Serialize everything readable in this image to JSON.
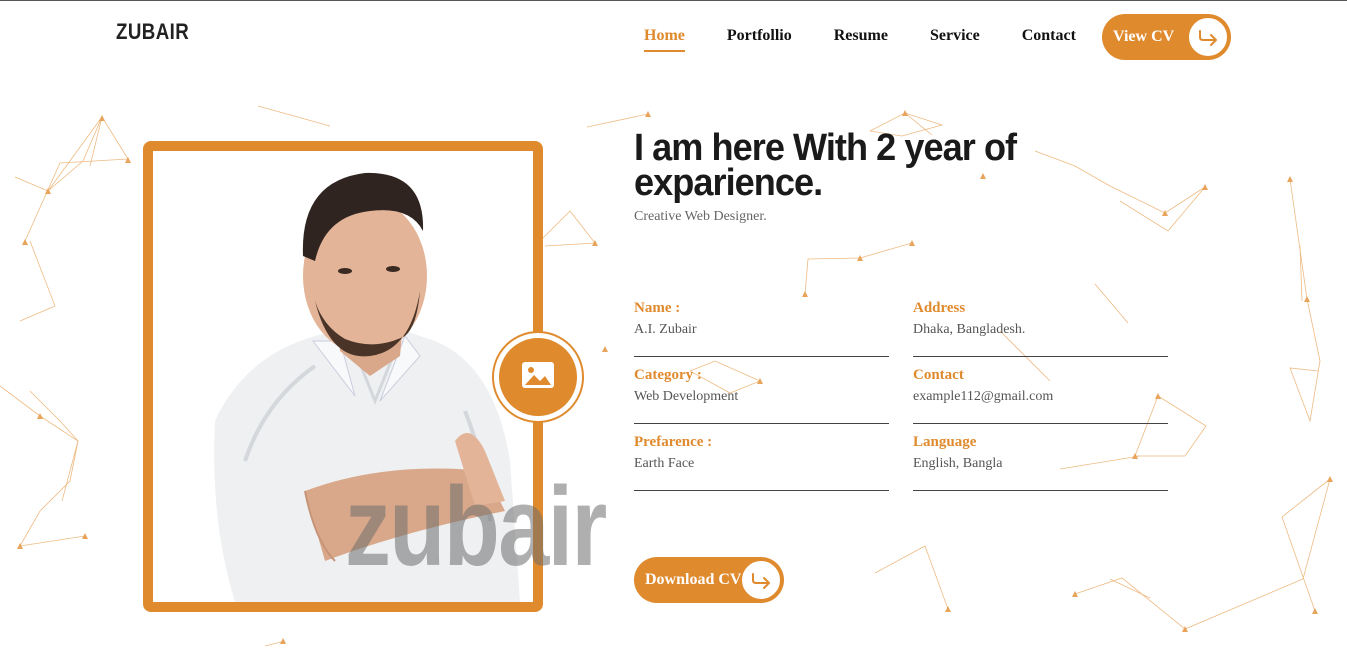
{
  "brand": {
    "logo": "ZUBAIR"
  },
  "nav": {
    "items": [
      "Home",
      "Portfollio",
      "Resume",
      "Service",
      "Contact"
    ],
    "active": "Home"
  },
  "header": {
    "view_cv_label": "View CV"
  },
  "hero": {
    "heading": "I am here With 2 year of exparience.",
    "subheading": "Creative Web Designer.",
    "watermark": "zubair",
    "download_label": "Download CV"
  },
  "info": [
    {
      "label": "Name :",
      "value": "A.I. Zubair"
    },
    {
      "label": "Address",
      "value": "Dhaka, Bangladesh."
    },
    {
      "label": "Category :",
      "value": "Web Development"
    },
    {
      "label": "Contact",
      "value": "example112@gmail.com"
    },
    {
      "label": "Prefarence :",
      "value": "Earth Face"
    },
    {
      "label": "Language",
      "value": "English, Bangla"
    }
  ],
  "colors": {
    "accent": "#e08a2e",
    "text": "#1a1a1a",
    "muted": "#666666"
  },
  "icons": {
    "image": "image-icon",
    "arrow": "return-arrow-icon"
  }
}
